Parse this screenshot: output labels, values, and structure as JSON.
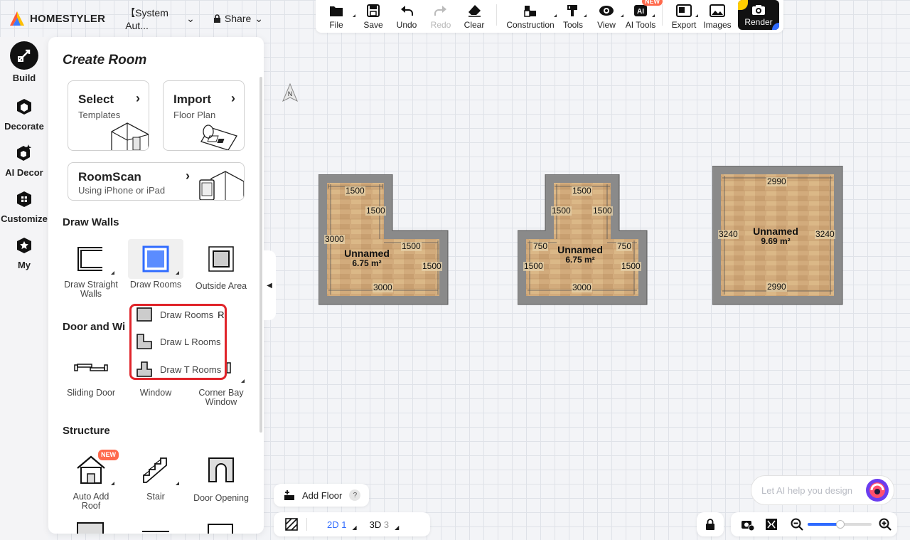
{
  "app": {
    "brand": "HOMESTYLER",
    "doc_title": "【System Aut...",
    "share_label": "Share"
  },
  "toolbar": {
    "items": [
      {
        "label": "File",
        "icon": "folder-icon"
      },
      {
        "label": "Save",
        "icon": "save-icon"
      },
      {
        "label": "Undo",
        "icon": "undo-icon"
      },
      {
        "label": "Redo",
        "icon": "redo-icon",
        "disabled": true
      },
      {
        "label": "Clear",
        "icon": "eraser-icon"
      },
      {
        "label": "Construction",
        "icon": "construction-icon"
      },
      {
        "label": "Tools",
        "icon": "tools-icon"
      },
      {
        "label": "View",
        "icon": "eye-icon"
      },
      {
        "label": "AI Tools",
        "icon": "ai-icon",
        "badge": "NEW"
      },
      {
        "label": "Export",
        "icon": "export-icon"
      },
      {
        "label": "Images",
        "icon": "images-icon"
      }
    ],
    "render_label": "Render"
  },
  "rail": {
    "items": [
      {
        "label": "Build",
        "active": true
      },
      {
        "label": "Decorate"
      },
      {
        "label": "AI Decor"
      },
      {
        "label": "Customize"
      },
      {
        "label": "My"
      }
    ]
  },
  "panel": {
    "title": "Create Room",
    "cards": [
      {
        "title": "Select",
        "subtitle": "Templates"
      },
      {
        "title": "Import",
        "subtitle": "Floor Plan"
      },
      {
        "title": "RoomScan",
        "subtitle": "Using iPhone or iPad"
      }
    ],
    "draw_walls": {
      "heading": "Draw Walls",
      "tiles": [
        "Draw Straight Walls",
        "Draw Rooms",
        "Outside Area"
      ]
    },
    "door_window": {
      "heading": "Door and Wi",
      "tiles": [
        "Sliding Door",
        "Window",
        "Corner Bay Window"
      ]
    },
    "structure": {
      "heading": "Structure",
      "tiles": [
        "Auto Add Roof",
        "Stair",
        "Door Opening"
      ],
      "badge": "NEW"
    }
  },
  "dropdown": {
    "items": [
      {
        "label": "Draw Rooms",
        "shortcut": "R"
      },
      {
        "label": "Draw L Rooms"
      },
      {
        "label": "Draw T Rooms"
      }
    ]
  },
  "compass": "N",
  "rooms": [
    {
      "name": "Unnamed",
      "area": "6.75 m²",
      "dims": [
        "1500",
        "1500",
        "3000",
        "1500",
        "1500",
        "3000"
      ]
    },
    {
      "name": "Unnamed",
      "area": "6.75 m²",
      "dims": [
        "1500",
        "1500",
        "1500",
        "750",
        "750",
        "1500",
        "1500",
        "3000"
      ]
    },
    {
      "name": "Unnamed",
      "area": "9.69 m²",
      "dims": [
        "2990",
        "3240",
        "3240",
        "2990"
      ]
    }
  ],
  "bottom": {
    "add_floor": "Add Floor",
    "help": "?",
    "view_2d": "2D",
    "view_2d_count": "1",
    "view_3d": "3D",
    "view_3d_count": "3",
    "ai_placeholder": "Let AI help you design"
  }
}
